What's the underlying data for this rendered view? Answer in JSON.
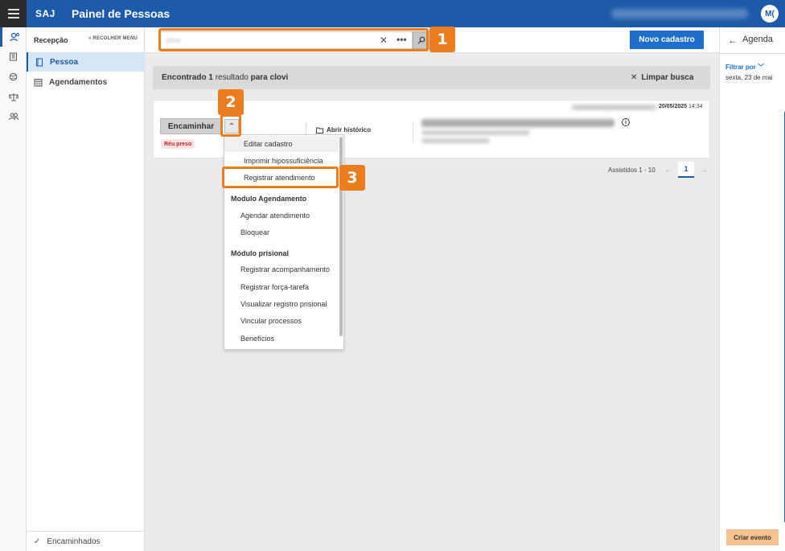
{
  "header": {
    "brand": "SAJ",
    "title": "Painel de Pessoas",
    "avatar_initials": "M(",
    "accent_color": "#1d5ba8"
  },
  "rail": {
    "icons": [
      "people-search-icon",
      "building-icon",
      "globe-icon",
      "scales-icon",
      "group-icon"
    ]
  },
  "sidebar": {
    "title": "Recepção",
    "collapse_label": "RECOLHER MENU",
    "items": [
      {
        "label": "Pessoa",
        "icon": "book-icon",
        "active": true
      },
      {
        "label": "Agendamentos",
        "icon": "calendar-grid-icon",
        "active": false
      }
    ],
    "bottom_item": "Encaminhados"
  },
  "toolbar": {
    "search_value": "clovi",
    "new_button": "Novo cadastro"
  },
  "results": {
    "prefix": "Encontrado",
    "count": "1",
    "middle": "resultado",
    "suffix": "para clovi",
    "clear_label": "Limpar busca"
  },
  "card": {
    "date": "20/05/2025",
    "time": "14:34",
    "forward_label": "Encaminhar",
    "badge": "Réu preso",
    "history_label": "Abrir histórico"
  },
  "pagination": {
    "label": "Assistidos 1 - 10",
    "current_page": "1"
  },
  "dropdown": {
    "items_top": [
      "Editar cadastro",
      "Imprimir hipossuficiência",
      "Registrar atendimento"
    ],
    "section1_title": "Modulo Agendamento",
    "section1_items": [
      "Agendar atendimento",
      "Bloquear"
    ],
    "section2_title": "Módulo prisional",
    "section2_items": [
      "Registrar acompanhamento",
      "Registrar força-tarefa",
      "Visualizar registro prisional",
      "Vincular processos",
      "Benefícios"
    ]
  },
  "callouts": [
    "1",
    "2",
    "3"
  ],
  "right_panel": {
    "title": "Agenda",
    "filter_label": "Filtrar por",
    "date_text": "sexta, 23 de mai",
    "event_button": "Criar evento"
  },
  "colors": {
    "callout": "#ec7d1f",
    "primary_button": "#1d6fc9",
    "event_button": "#f6c38e"
  }
}
